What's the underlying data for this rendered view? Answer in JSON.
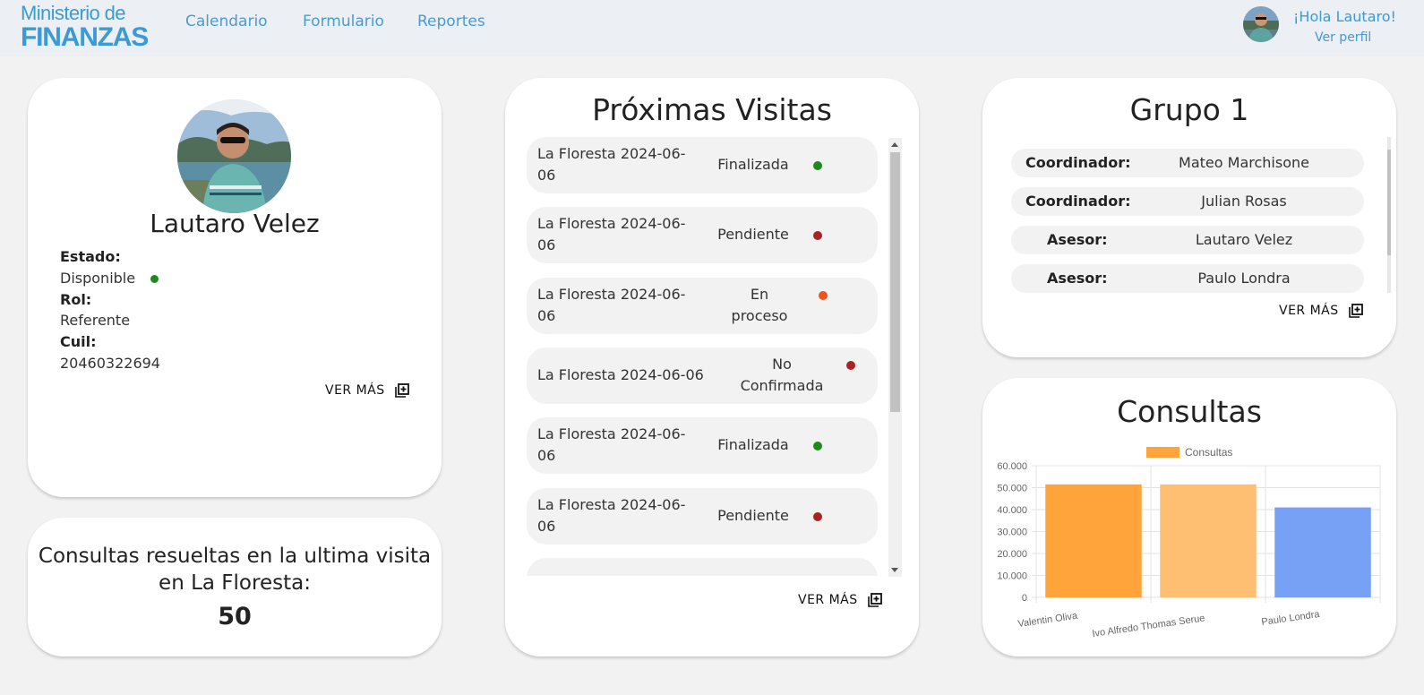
{
  "nav": {
    "logo_line1": "Ministerio de",
    "logo_line2": "FINANZAS",
    "links": [
      "Calendario",
      "Formulario",
      "Reportes"
    ],
    "greeting": "¡Hola Lautaro!",
    "profile_link": "Ver perfil"
  },
  "profile": {
    "name": "Lautaro Velez",
    "estado_label": "Estado:",
    "estado_value": "Disponible",
    "estado_color": "#1e8a1e",
    "rol_label": "Rol:",
    "rol_value": "Referente",
    "cuil_label": "Cuil:",
    "cuil_value": "20460322694",
    "ver_mas": "VER MÁS"
  },
  "resueltas": {
    "text": "Consultas resueltas en la ultima visita en La Floresta:",
    "value": "50"
  },
  "visitas": {
    "title": "Próximas Visitas",
    "ver_mas": "VER MÁS",
    "rows": [
      {
        "loc1": "La Floresta 2024-06-",
        "loc2": "06",
        "status1": "Finalizada",
        "status2": "",
        "color": "#1e8a1e"
      },
      {
        "loc1": "La Floresta 2024-06-",
        "loc2": "06",
        "status1": "Pendiente",
        "status2": "",
        "color": "#a82424"
      },
      {
        "loc1": "La Floresta 2024-06-",
        "loc2": "06",
        "status1": "En",
        "status2": "proceso",
        "color": "#f0531c"
      },
      {
        "loc1": "La Floresta 2024-06-06",
        "loc2": "",
        "status1": "No",
        "status2": "Confirmada",
        "color": "#a82424"
      },
      {
        "loc1": "La Floresta 2024-06-",
        "loc2": "06",
        "status1": "Finalizada",
        "status2": "",
        "color": "#1e8a1e"
      },
      {
        "loc1": "La Floresta 2024-06-",
        "loc2": "06",
        "status1": "Pendiente",
        "status2": "",
        "color": "#a82424"
      }
    ]
  },
  "grupo": {
    "title": "Grupo 1",
    "ver_mas": "VER MÁS",
    "members": [
      {
        "role": "Coordinador:",
        "name": "Mateo Marchisone"
      },
      {
        "role": "Coordinador:",
        "name": "Julian Rosas"
      },
      {
        "role": "Asesor:",
        "name": "Lautaro Velez"
      },
      {
        "role": "Asesor:",
        "name": "Paulo Londra"
      }
    ]
  },
  "consultas": {
    "title": "Consultas"
  },
  "chart_data": {
    "type": "bar",
    "title": "Consultas",
    "categories": [
      "Valentin Oliva",
      "Ivo Alfredo Thomas Serue",
      "Paulo Londra"
    ],
    "series": [
      {
        "name": "Consultas",
        "values": [
          51500,
          51500,
          41000
        ]
      }
    ],
    "colors": [
      "#ffa43a",
      "#ffbf73",
      "#77a1f5"
    ],
    "legend_color": "#ffa43a",
    "ylim": [
      0,
      60000
    ],
    "yticks": [
      "0",
      "10.000",
      "20.000",
      "30.000",
      "40.000",
      "50.000",
      "60.000"
    ],
    "legend_position": "top",
    "grid": true
  }
}
